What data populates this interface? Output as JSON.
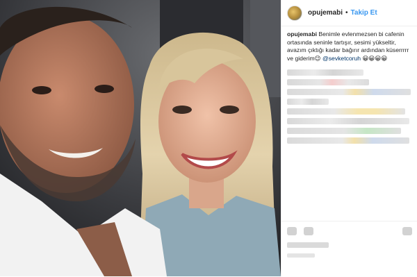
{
  "post": {
    "username": "opujemabi",
    "separator": "•",
    "follow_label": "Takip Et",
    "caption_user": "opujemabi",
    "caption_text": "Benimle evlenmezsen bi cafenin ortasında seninle tartışır, sesimi yükseltir, avazım çıktığı kadar bağırır ardından küserrrrr ve giderim",
    "caption_emoji": "😉",
    "mention": "@sevketcoruh",
    "trailing_emoji": "😀😀😀😀",
    "photo_alt": "selfie"
  }
}
